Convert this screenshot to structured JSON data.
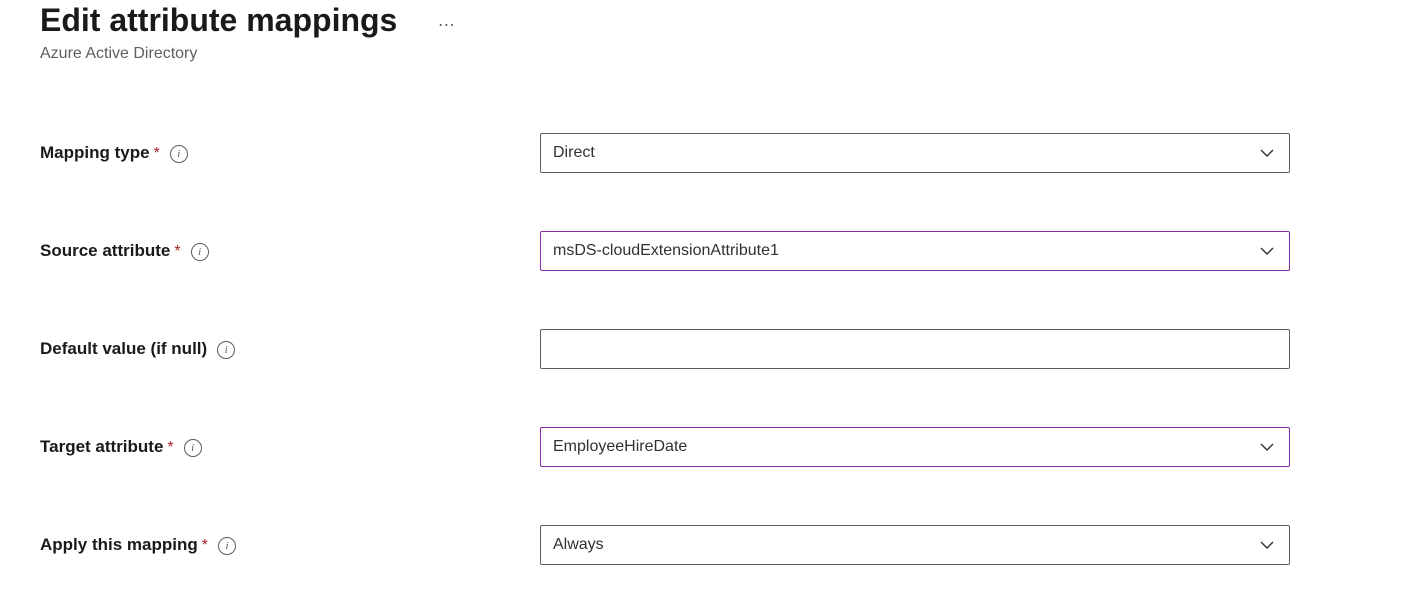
{
  "header": {
    "title": "Edit attribute mappings",
    "subtitle": "Azure Active Directory",
    "more": "…"
  },
  "form": {
    "mapping_type": {
      "label": "Mapping type",
      "value": "Direct",
      "required": true
    },
    "source_attribute": {
      "label": "Source attribute",
      "value": "msDS-cloudExtensionAttribute1",
      "required": true
    },
    "default_value": {
      "label": "Default value (if null)",
      "value": ""
    },
    "target_attribute": {
      "label": "Target attribute",
      "value": "EmployeeHireDate",
      "required": true
    },
    "apply_mapping": {
      "label": "Apply this mapping",
      "value": "Always",
      "required": true
    }
  },
  "glyphs": {
    "required": "*",
    "info": "i"
  }
}
